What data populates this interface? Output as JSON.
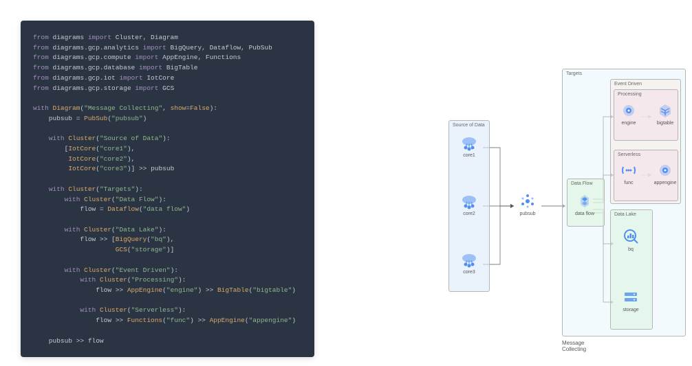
{
  "code": {
    "lines": [
      {
        "parts": [
          {
            "t": "from",
            "c": "kw"
          },
          {
            "t": " diagrams ",
            "c": ""
          },
          {
            "t": "import",
            "c": "imp"
          },
          {
            "t": " Cluster, Diagram",
            "c": ""
          }
        ]
      },
      {
        "parts": [
          {
            "t": "from",
            "c": "kw"
          },
          {
            "t": " diagrams.gcp.analytics ",
            "c": ""
          },
          {
            "t": "import",
            "c": "imp"
          },
          {
            "t": " BigQuery, Dataflow, PubSub",
            "c": ""
          }
        ]
      },
      {
        "parts": [
          {
            "t": "from",
            "c": "kw"
          },
          {
            "t": " diagrams.gcp.compute ",
            "c": ""
          },
          {
            "t": "import",
            "c": "imp"
          },
          {
            "t": " AppEngine, Functions",
            "c": ""
          }
        ]
      },
      {
        "parts": [
          {
            "t": "from",
            "c": "kw"
          },
          {
            "t": " diagrams.gcp.database ",
            "c": ""
          },
          {
            "t": "import",
            "c": "imp"
          },
          {
            "t": " BigTable",
            "c": ""
          }
        ]
      },
      {
        "parts": [
          {
            "t": "from",
            "c": "kw"
          },
          {
            "t": " diagrams.gcp.iot ",
            "c": ""
          },
          {
            "t": "import",
            "c": "imp"
          },
          {
            "t": " IotCore",
            "c": ""
          }
        ]
      },
      {
        "parts": [
          {
            "t": "from",
            "c": "kw"
          },
          {
            "t": " diagrams.gcp.storage ",
            "c": ""
          },
          {
            "t": "import",
            "c": "imp"
          },
          {
            "t": " GCS",
            "c": ""
          }
        ]
      },
      {
        "parts": [
          {
            "t": "",
            "c": ""
          }
        ]
      },
      {
        "parts": [
          {
            "t": "with",
            "c": "kw"
          },
          {
            "t": " ",
            "c": ""
          },
          {
            "t": "Diagram",
            "c": "cls"
          },
          {
            "t": "(",
            "c": ""
          },
          {
            "t": "\"Message Collecting\"",
            "c": "str"
          },
          {
            "t": ", ",
            "c": ""
          },
          {
            "t": "show",
            "c": "arg"
          },
          {
            "t": "=",
            "c": ""
          },
          {
            "t": "False",
            "c": "arg"
          },
          {
            "t": "):",
            "c": ""
          }
        ]
      },
      {
        "parts": [
          {
            "t": "    pubsub = ",
            "c": ""
          },
          {
            "t": "PubSub",
            "c": "cls"
          },
          {
            "t": "(",
            "c": ""
          },
          {
            "t": "\"pubsub\"",
            "c": "str"
          },
          {
            "t": ")",
            "c": ""
          }
        ]
      },
      {
        "parts": [
          {
            "t": "",
            "c": ""
          }
        ]
      },
      {
        "parts": [
          {
            "t": "    ",
            "c": ""
          },
          {
            "t": "with",
            "c": "kw"
          },
          {
            "t": " ",
            "c": ""
          },
          {
            "t": "Cluster",
            "c": "cls"
          },
          {
            "t": "(",
            "c": ""
          },
          {
            "t": "\"Source of Data\"",
            "c": "str"
          },
          {
            "t": "):",
            "c": ""
          }
        ]
      },
      {
        "parts": [
          {
            "t": "        [",
            "c": ""
          },
          {
            "t": "IotCore",
            "c": "cls"
          },
          {
            "t": "(",
            "c": ""
          },
          {
            "t": "\"core1\"",
            "c": "str"
          },
          {
            "t": "),",
            "c": ""
          }
        ]
      },
      {
        "parts": [
          {
            "t": "         ",
            "c": ""
          },
          {
            "t": "IotCore",
            "c": "cls"
          },
          {
            "t": "(",
            "c": ""
          },
          {
            "t": "\"core2\"",
            "c": "str"
          },
          {
            "t": "),",
            "c": ""
          }
        ]
      },
      {
        "parts": [
          {
            "t": "         ",
            "c": ""
          },
          {
            "t": "IotCore",
            "c": "cls"
          },
          {
            "t": "(",
            "c": ""
          },
          {
            "t": "\"core3\"",
            "c": "str"
          },
          {
            "t": ")] >> pubsub",
            "c": ""
          }
        ]
      },
      {
        "parts": [
          {
            "t": "",
            "c": ""
          }
        ]
      },
      {
        "parts": [
          {
            "t": "    ",
            "c": ""
          },
          {
            "t": "with",
            "c": "kw"
          },
          {
            "t": " ",
            "c": ""
          },
          {
            "t": "Cluster",
            "c": "cls"
          },
          {
            "t": "(",
            "c": ""
          },
          {
            "t": "\"Targets\"",
            "c": "str"
          },
          {
            "t": "):",
            "c": ""
          }
        ]
      },
      {
        "parts": [
          {
            "t": "        ",
            "c": ""
          },
          {
            "t": "with",
            "c": "kw"
          },
          {
            "t": " ",
            "c": ""
          },
          {
            "t": "Cluster",
            "c": "cls"
          },
          {
            "t": "(",
            "c": ""
          },
          {
            "t": "\"Data Flow\"",
            "c": "str"
          },
          {
            "t": "):",
            "c": ""
          }
        ]
      },
      {
        "parts": [
          {
            "t": "            flow = ",
            "c": ""
          },
          {
            "t": "Dataflow",
            "c": "cls"
          },
          {
            "t": "(",
            "c": ""
          },
          {
            "t": "\"data flow\"",
            "c": "str"
          },
          {
            "t": ")",
            "c": ""
          }
        ]
      },
      {
        "parts": [
          {
            "t": "",
            "c": ""
          }
        ]
      },
      {
        "parts": [
          {
            "t": "        ",
            "c": ""
          },
          {
            "t": "with",
            "c": "kw"
          },
          {
            "t": " ",
            "c": ""
          },
          {
            "t": "Cluster",
            "c": "cls"
          },
          {
            "t": "(",
            "c": ""
          },
          {
            "t": "\"Data Lake\"",
            "c": "str"
          },
          {
            "t": "):",
            "c": ""
          }
        ]
      },
      {
        "parts": [
          {
            "t": "            flow >> [",
            "c": ""
          },
          {
            "t": "BigQuery",
            "c": "cls"
          },
          {
            "t": "(",
            "c": ""
          },
          {
            "t": "\"bq\"",
            "c": "str"
          },
          {
            "t": "),",
            "c": ""
          }
        ]
      },
      {
        "parts": [
          {
            "t": "                     ",
            "c": ""
          },
          {
            "t": "GCS",
            "c": "cls"
          },
          {
            "t": "(",
            "c": ""
          },
          {
            "t": "\"storage\"",
            "c": "str"
          },
          {
            "t": ")]",
            "c": ""
          }
        ]
      },
      {
        "parts": [
          {
            "t": "",
            "c": ""
          }
        ]
      },
      {
        "parts": [
          {
            "t": "        ",
            "c": ""
          },
          {
            "t": "with",
            "c": "kw"
          },
          {
            "t": " ",
            "c": ""
          },
          {
            "t": "Cluster",
            "c": "cls"
          },
          {
            "t": "(",
            "c": ""
          },
          {
            "t": "\"Event Driven\"",
            "c": "str"
          },
          {
            "t": "):",
            "c": ""
          }
        ]
      },
      {
        "parts": [
          {
            "t": "            ",
            "c": ""
          },
          {
            "t": "with",
            "c": "kw"
          },
          {
            "t": " ",
            "c": ""
          },
          {
            "t": "Cluster",
            "c": "cls"
          },
          {
            "t": "(",
            "c": ""
          },
          {
            "t": "\"Processing\"",
            "c": "str"
          },
          {
            "t": "):",
            "c": ""
          }
        ]
      },
      {
        "parts": [
          {
            "t": "                flow >> ",
            "c": ""
          },
          {
            "t": "AppEngine",
            "c": "cls"
          },
          {
            "t": "(",
            "c": ""
          },
          {
            "t": "\"engine\"",
            "c": "str"
          },
          {
            "t": ") >> ",
            "c": ""
          },
          {
            "t": "BigTable",
            "c": "cls"
          },
          {
            "t": "(",
            "c": ""
          },
          {
            "t": "\"bigtable\"",
            "c": "str"
          },
          {
            "t": ")",
            "c": ""
          }
        ]
      },
      {
        "parts": [
          {
            "t": "",
            "c": ""
          }
        ]
      },
      {
        "parts": [
          {
            "t": "            ",
            "c": ""
          },
          {
            "t": "with",
            "c": "kw"
          },
          {
            "t": " ",
            "c": ""
          },
          {
            "t": "Cluster",
            "c": "cls"
          },
          {
            "t": "(",
            "c": ""
          },
          {
            "t": "\"Serverless\"",
            "c": "str"
          },
          {
            "t": "):",
            "c": ""
          }
        ]
      },
      {
        "parts": [
          {
            "t": "                flow >> ",
            "c": ""
          },
          {
            "t": "Functions",
            "c": "cls"
          },
          {
            "t": "(",
            "c": ""
          },
          {
            "t": "\"func\"",
            "c": "str"
          },
          {
            "t": ") >> ",
            "c": ""
          },
          {
            "t": "AppEngine",
            "c": "cls"
          },
          {
            "t": "(",
            "c": ""
          },
          {
            "t": "\"appengine\"",
            "c": "str"
          },
          {
            "t": ")",
            "c": ""
          }
        ]
      },
      {
        "parts": [
          {
            "t": "",
            "c": ""
          }
        ]
      },
      {
        "parts": [
          {
            "t": "    pubsub >> flow",
            "c": ""
          }
        ]
      }
    ]
  },
  "diagram": {
    "title": "Message Collecting",
    "clusters": {
      "src": "Source of Data",
      "targets": "Targets",
      "dataflow": "Data Flow",
      "eventdriven": "Event Driven",
      "processing": "Processing",
      "serverless": "Serverless",
      "datalake": "Data Lake"
    },
    "nodes": {
      "core1": "core1",
      "core2": "core2",
      "core3": "core3",
      "pubsub": "pubsub",
      "dataflow": "data flow",
      "engine": "engine",
      "bigtable": "bigtable",
      "func": "func",
      "appengine": "appengine",
      "bq": "bq",
      "storage": "storage"
    }
  }
}
